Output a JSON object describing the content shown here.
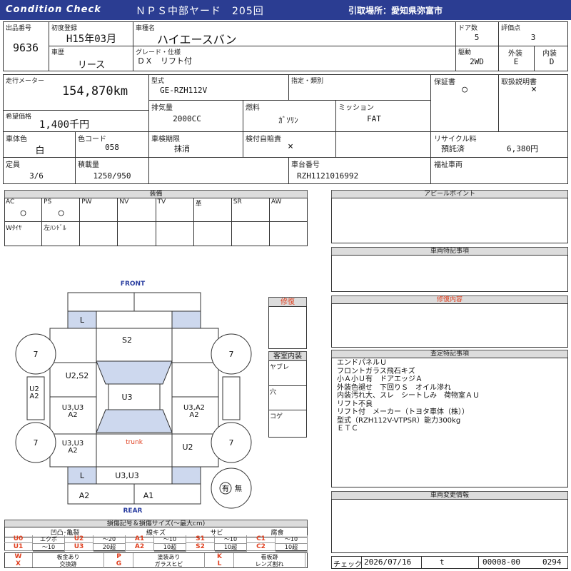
{
  "header": {
    "title": "Condition Check",
    "auction": "ＮＰＳ中部ヤード　205回",
    "pickup": "引取場所：愛知県弥富市"
  },
  "vehicle": {
    "lot_label": "出品番号",
    "lot": "9636",
    "firstreg_label": "初度登録",
    "firstreg": "H15年03月",
    "name_label": "車種名",
    "name": "ハイエースバン",
    "doors_label": "ドア数",
    "doors": "5",
    "score_label": "評価点",
    "score": "3",
    "history_label": "車歴",
    "history": "リース",
    "grade_label": "グレード・仕様",
    "grade": "ＤＸ　リフト付",
    "drive_label": "駆動",
    "drive": "2WD",
    "ext_label": "外装",
    "ext": "E",
    "int_label": "内装",
    "int": "D",
    "mileage_label": "走行メーター",
    "mileage": "154,870km",
    "model_label": "型式",
    "model": "GE-RZH112V",
    "designation_label": "指定・類別",
    "warranty_label": "保証書",
    "warranty": "○",
    "manual_label": "取扱説明書",
    "manual": "×",
    "price_label": "希望価格",
    "price": "1,400千円",
    "displacement_label": "排気量",
    "displacement": "2000CC",
    "fuel_label": "燃料",
    "fuel": "ｶﾞｿﾘﾝ",
    "transmission_label": "ミッション",
    "transmission": "FAT",
    "color_label": "車体色",
    "color": "白",
    "color_code_label": "色コード",
    "color_code": "058",
    "inspection_label": "車検期限",
    "inspection": "抹消",
    "insurance_label": "検付自賠責",
    "insurance": "×",
    "recycle_label": "リサイクル料",
    "recycle_status": "預託済",
    "recycle_fee": "6,380円",
    "capacity_label": "定員",
    "capacity": "3/6",
    "load_label": "積載量",
    "load": "1250/950",
    "chassis_label": "車台番号",
    "chassis": "RZH1121016992",
    "welfare_label": "福祉車両"
  },
  "equipment": {
    "title": "装備",
    "row1": [
      {
        "label": "AC",
        "value": "○"
      },
      {
        "label": "PS",
        "value": "○"
      },
      {
        "label": "PW",
        "value": ""
      },
      {
        "label": "NV",
        "value": ""
      },
      {
        "label": "TV",
        "value": ""
      },
      {
        "label": "革",
        "value": ""
      },
      {
        "label": "SR",
        "value": ""
      },
      {
        "label": "AW",
        "value": ""
      }
    ],
    "row2": [
      {
        "label": "Wﾀｲﾔ",
        "value": ""
      },
      {
        "label": "左ﾊﾝﾄﾞﾙ",
        "value": ""
      },
      {
        "label": "",
        "value": ""
      },
      {
        "label": "",
        "value": ""
      },
      {
        "label": "",
        "value": ""
      },
      {
        "label": "",
        "value": ""
      },
      {
        "label": "",
        "value": ""
      },
      {
        "label": "",
        "value": ""
      }
    ]
  },
  "diagram": {
    "front": "FRONT",
    "rear": "REAR",
    "trunk": "trunk",
    "tires": [
      "7",
      "7",
      "7",
      "7",
      "7",
      "7"
    ],
    "marks": {
      "front_l": "L",
      "hood": "S2",
      "left_front_door": "U2,S2",
      "roof": "U3",
      "left_mid": "U3,U3\nA2",
      "left_rear": "U3,U3\nA2",
      "right_mid": "U3,A2\nA2",
      "right_rear": "U2",
      "rear_l": "L",
      "rear_center": "U3,U3",
      "bumper_left": "A2",
      "bumper_right": "A1",
      "side_left": "U2\nA2"
    },
    "spare_circle": "有",
    "spare_none": "無"
  },
  "repair": {
    "title": "修復"
  },
  "cabin": {
    "title": "客室内装",
    "items": [
      "ヤブレ",
      "穴",
      "コゲ"
    ]
  },
  "appeal": {
    "title": "アピールポイント",
    "text": ""
  },
  "special": {
    "title": "車両特記事項",
    "text": ""
  },
  "repair_content": {
    "title": "修復内容",
    "text": ""
  },
  "inspection_notes": {
    "title": "査定特記事項",
    "lines": [
      "エンドパネルＵ",
      "フロントガラス飛石キズ",
      "小Ａ小Ｕ有　ドアエッジＡ",
      "外装色褪せ　下回りＳ　オイル滲れ",
      "内装汚れ大、スレ　シートしみ　荷物室ＡＵ",
      "リフト不良",
      "リフト付　メーカー（トヨタ車体（株））",
      "型式（RZH112V-VTPSR）能力300kg",
      "ＥＴＣ"
    ]
  },
  "change_info": {
    "title": "車両変更情報"
  },
  "legend": {
    "title": "損傷記号＆損傷サイズ(～最大cm)",
    "groups": [
      "凹凸･亀裂",
      "線キズ",
      "サビ",
      "腐食"
    ],
    "rows": [
      [
        "U0",
        "エクボ",
        "U2",
        "～20",
        "A1",
        "～10",
        "S1",
        "～10",
        "C1",
        "～10"
      ],
      [
        "U1",
        "～10",
        "U3",
        "20超",
        "A2",
        "10超",
        "S2",
        "10超",
        "C2",
        "10超"
      ]
    ],
    "extra": [
      [
        "W",
        "板金あり",
        "P",
        "塗装あり",
        "K",
        "看板跡"
      ],
      [
        "X",
        "交換跡",
        "G",
        "ガラスヒビ",
        "L",
        "レンズ割れ"
      ]
    ]
  },
  "footer": {
    "check_label": "チェック",
    "date": "2026/07/16",
    "t": "t",
    "code": "00008-00",
    "num": "0294"
  },
  "colors": {
    "header_bg": "#2b3d92",
    "red": "#e04020",
    "blue": "#2a3ea0",
    "light_blue": "#cdd8ee"
  }
}
